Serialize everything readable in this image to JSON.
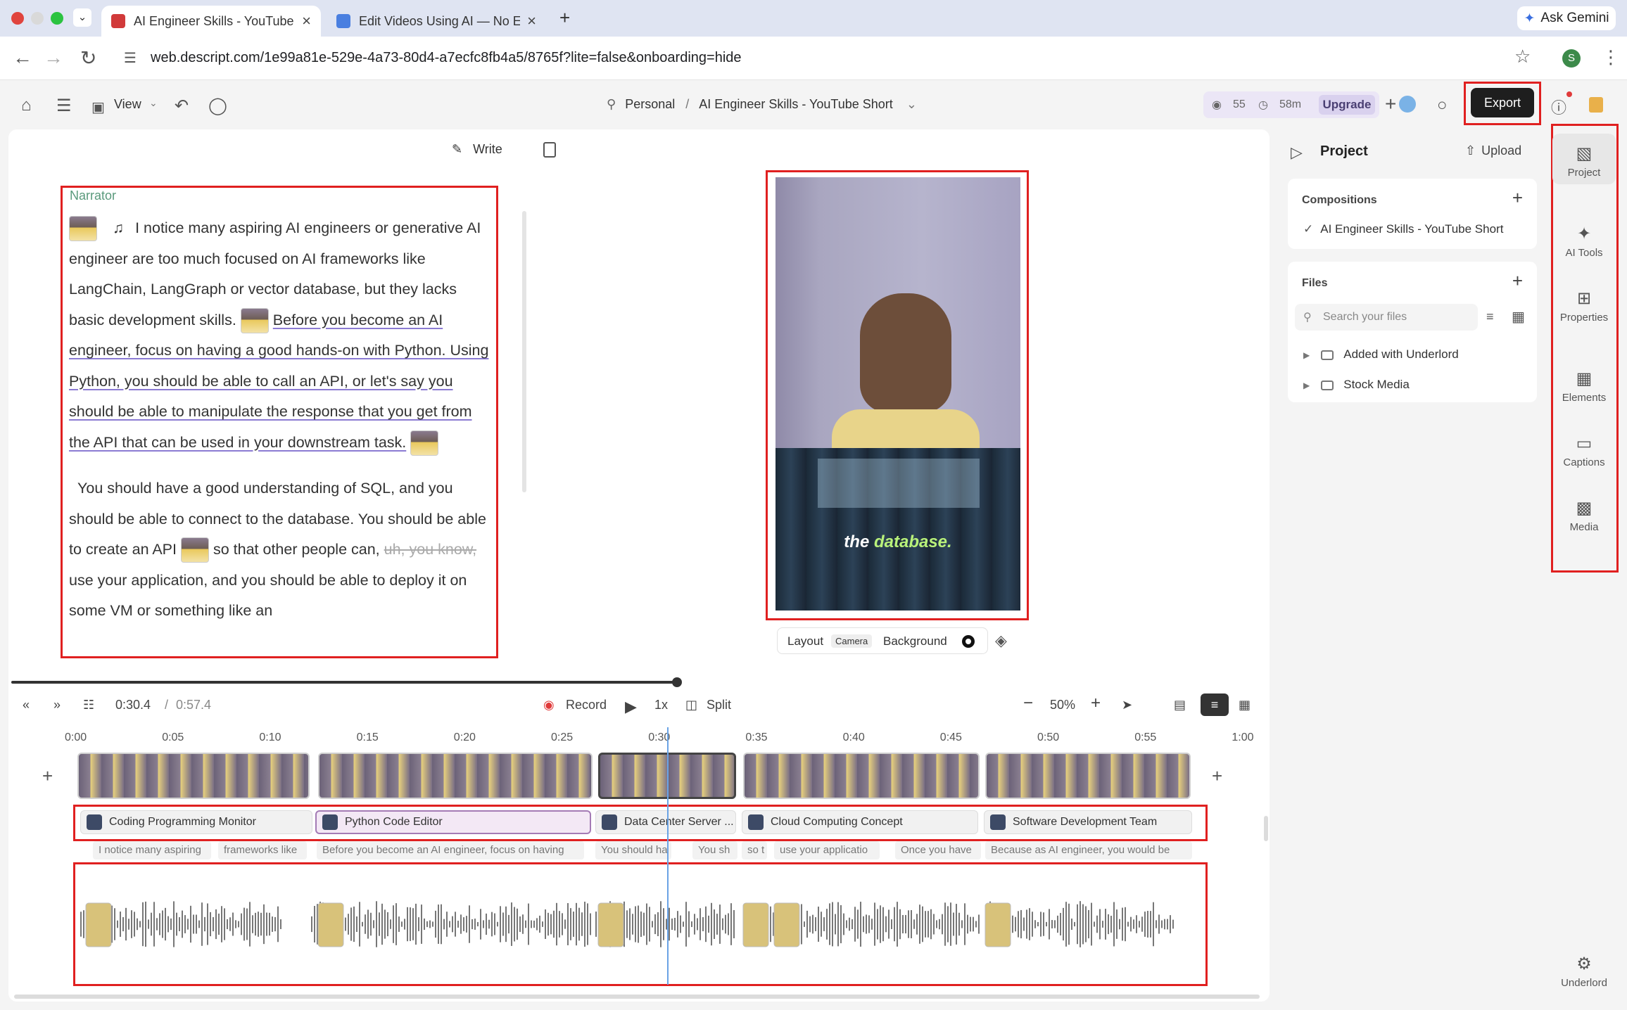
{
  "browser": {
    "tabs": [
      {
        "title": "AI Engineer Skills - YouTube",
        "active": true,
        "favicon_color": "#d13a3a"
      },
      {
        "title": "Edit Videos Using AI — No Ed",
        "active": false,
        "favicon_color": "#4a7fe0"
      }
    ],
    "url": "web.descript.com/1e99a81e-529e-4a73-80d4-a7ecfc8fb4a5/8765f?lite=false&onboarding=hide",
    "ask_gemini": "Ask Gemini",
    "profile_initial": "S"
  },
  "toolbar": {
    "view_label": "View",
    "breadcrumb_workspace": "Personal",
    "breadcrumb_separator": "/",
    "breadcrumb_project": "AI Engineer Skills - YouTube Short",
    "credits_count": "55",
    "credits_time": "58m",
    "upgrade_label": "Upgrade",
    "export_label": "Export"
  },
  "script": {
    "write_label": "Write",
    "speaker": "Narrator",
    "para1_a": "I notice many aspiring AI engineers or generative AI engineer are too much focused on AI frameworks like LangChain, LangGraph or vector database, but they lacks basic development skills.",
    "para1_b": "Before you become an AI engineer, focus on having a good hands-on with Python. Using Python, you should be able to call an API, or let's say you should be able to manipulate the response that you get from the API that can be used in your downstream task.",
    "para2_a": "You should have a good understanding of SQL, and you should be able to connect to the database. You should be able to create an API",
    "para2_b": "so that other people can,",
    "para2_strike": "uh, you know,",
    "para2_c": "use your application, and you should be able to deploy it on some VM or something like an"
  },
  "preview": {
    "caption_prefix": "the",
    "caption_word": "database.",
    "layout_label": "Layout",
    "layout_value": "Camera",
    "background_label": "Background"
  },
  "project_panel": {
    "title": "Project",
    "upload_label": "Upload",
    "compositions_label": "Compositions",
    "composition_item": "AI Engineer Skills - YouTube Short",
    "files_label": "Files",
    "search_placeholder": "Search your files",
    "folders": [
      "Added with Underlord",
      "Stock Media"
    ]
  },
  "rail": {
    "items": [
      "Project",
      "AI Tools",
      "Properties",
      "Elements",
      "Captions",
      "Media"
    ],
    "bottom_item": "Underlord"
  },
  "timeline": {
    "current_time": "0:30.4",
    "total_time": "0:57.4",
    "time_separator": "/",
    "record_label": "Record",
    "speed_label": "1x",
    "split_label": "Split",
    "zoom_label": "50%",
    "ruler_ticks": [
      "0:00",
      "0:05",
      "0:10",
      "0:15",
      "0:20",
      "0:25",
      "0:30",
      "0:35",
      "0:40",
      "0:45",
      "0:50",
      "0:55",
      "1:00"
    ],
    "scenes": [
      "Coding Programming Monitor",
      "Python Code Editor",
      "Data Center Server ...",
      "Cloud Computing Concept",
      "Software Development Team"
    ],
    "words": [
      "I notice many aspiring",
      "frameworks like",
      "Before you become an AI engineer, focus on having",
      "You should ha",
      "You sh",
      "so t",
      "use your applicatio",
      "Once you have",
      "Because as AI engineer, you would be"
    ]
  }
}
